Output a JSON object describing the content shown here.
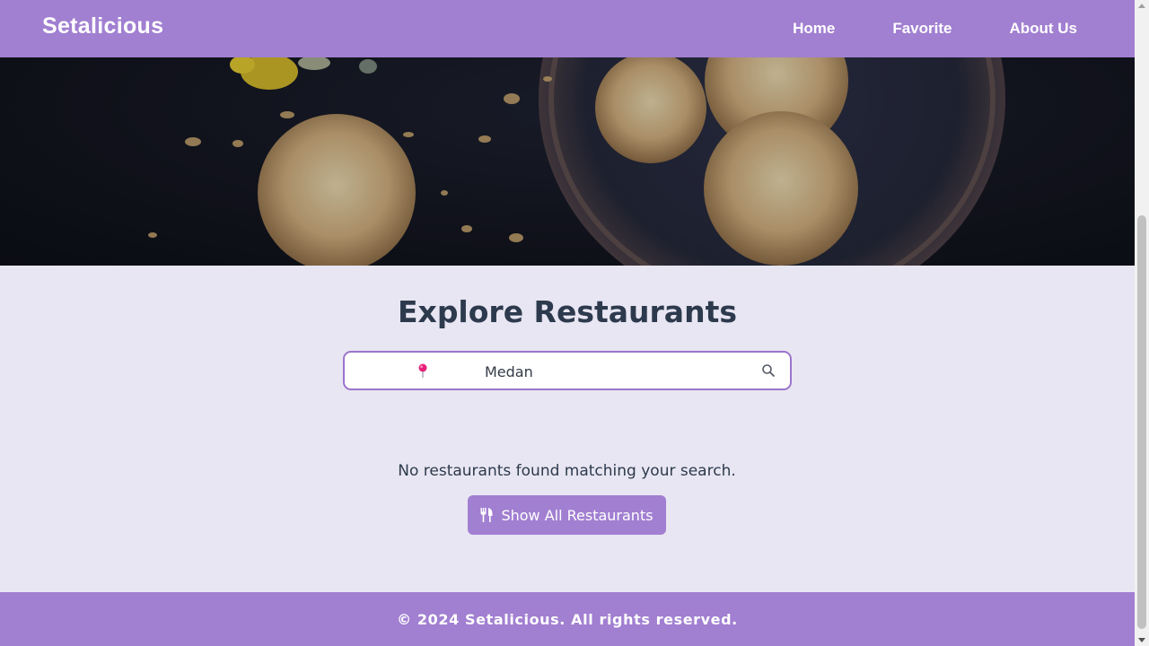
{
  "brand": "Setalicious",
  "nav": {
    "items": [
      {
        "label": "Home"
      },
      {
        "label": "Favorite"
      },
      {
        "label": "About Us"
      }
    ]
  },
  "main": {
    "title": "Explore Restaurants",
    "search": {
      "value": "Medan",
      "location_icon": "map-pin-icon",
      "search_icon": "search-icon"
    },
    "empty_message": "No restaurants found matching your search.",
    "show_all_button": {
      "label": "Show All Restaurants",
      "icon": "utensils-icon"
    }
  },
  "footer": {
    "text": "© 2024 Setalicious. All rights reserved."
  },
  "colors": {
    "accent": "#a17fd1",
    "background": "#e8e6f2",
    "text": "#2d3a4d",
    "pin": "#e8217a"
  }
}
